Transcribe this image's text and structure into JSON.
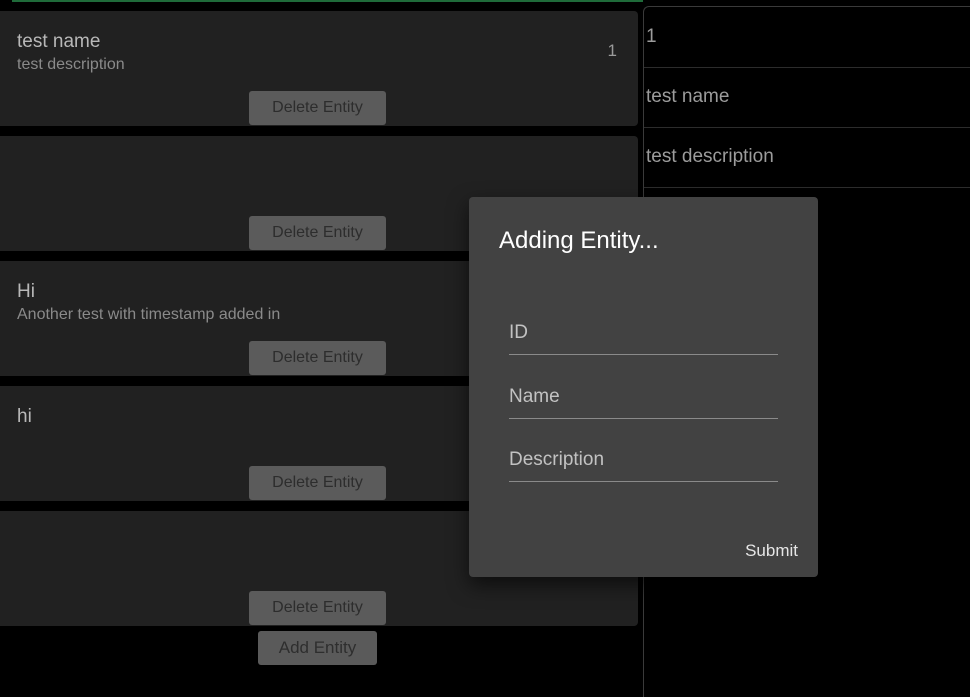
{
  "entities": [
    {
      "name": "test name",
      "description": "test description",
      "id": "1",
      "delete_label": "Delete Entity"
    },
    {
      "name": "",
      "description": "",
      "id": "",
      "delete_label": "Delete Entity"
    },
    {
      "name": "Hi",
      "description": "Another test with timestamp added in",
      "id": "",
      "delete_label": "Delete Entity"
    },
    {
      "name": "hi",
      "description": "",
      "id": "",
      "delete_label": "Delete Entity"
    },
    {
      "name": "",
      "description": "",
      "id": "",
      "delete_label": "Delete Entity"
    }
  ],
  "add_entity_label": "Add Entity",
  "detail": {
    "id": "1",
    "name": "test name",
    "description": "test description"
  },
  "dialog": {
    "title": "Adding Entity...",
    "fields": {
      "id": {
        "placeholder": "ID",
        "value": ""
      },
      "name": {
        "placeholder": "Name",
        "value": ""
      },
      "description": {
        "placeholder": "Description",
        "value": ""
      }
    },
    "submit_label": "Submit"
  }
}
